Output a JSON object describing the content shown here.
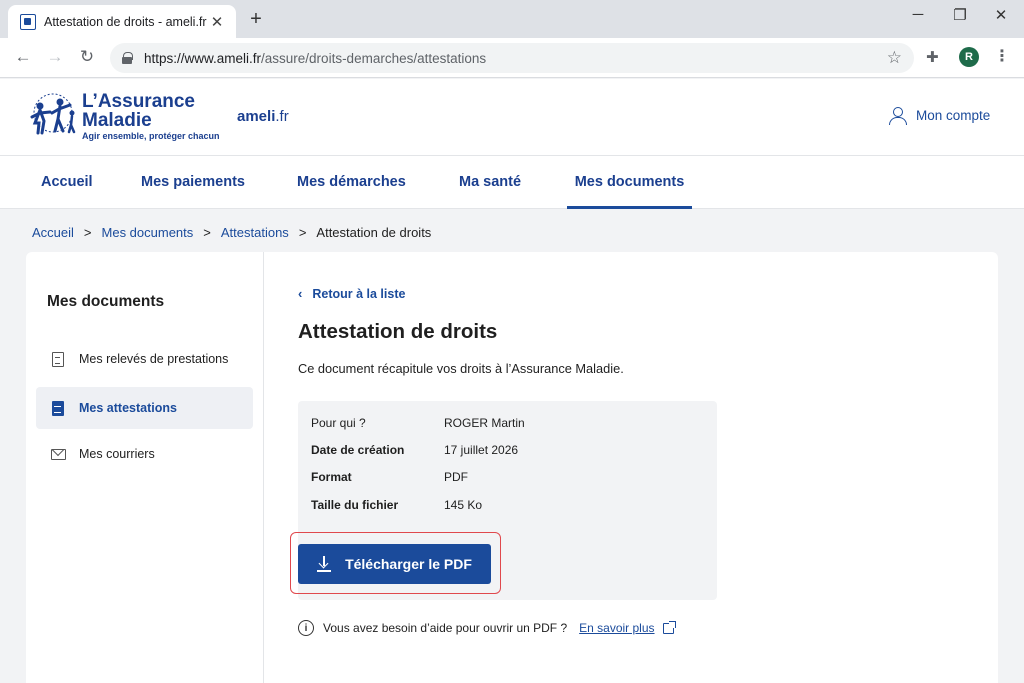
{
  "browser": {
    "tab_title": "Attestation de droits - ameli.fr",
    "tab_close": "✕",
    "new_tab": "+",
    "url_domain": "https://www.ameli.fr",
    "url_path": "/assure/droits-demarches/attestations",
    "profile_initial": "R",
    "icons": [
      "back-arrow-icon",
      "forward-arrow-icon",
      "reload-icon",
      "lock-icon",
      "star-icon",
      "extensions-icon",
      "kebab-menu-icon"
    ]
  },
  "header": {
    "logo_line1": "L’Assurance",
    "logo_line2": "Maladie",
    "logo_tagline": "Agir ensemble, protéger chacun",
    "site_name": "ameli",
    "site_tld": ".fr",
    "account_label": "Mon compte"
  },
  "nav": {
    "items": [
      {
        "label": "Accueil"
      },
      {
        "label": "Mes paiements"
      },
      {
        "label": "Mes démarches"
      },
      {
        "label": "Ma santé"
      },
      {
        "label": "Mes documents",
        "active": true
      }
    ]
  },
  "breadcrumb": {
    "items": [
      "Accueil",
      "Mes documents",
      "Attestations"
    ],
    "separator": ">",
    "current": "Attestation de droits"
  },
  "sidebar": {
    "title": "Mes documents",
    "items": [
      {
        "label": "Mes relevés de prestations",
        "icon": "document-icon"
      },
      {
        "label": "Mes attestations",
        "icon": "document-filled-icon",
        "active": true
      },
      {
        "label": "Mes courriers",
        "icon": "envelope-icon"
      }
    ]
  },
  "main": {
    "back_label": "Retour à la liste",
    "title": "Attestation de droits",
    "description": "Ce document récapitule vos droits à l’Assurance Maladie.",
    "details": [
      {
        "key": "Pour qui ?",
        "value": "ROGER Martin"
      },
      {
        "key": "Date de création",
        "value": "17 juillet 2026"
      },
      {
        "key": "Format",
        "value": "PDF"
      },
      {
        "key": "Taille du fichier",
        "value": "145 Ko"
      }
    ],
    "download_label": "Télécharger le PDF",
    "help_text": "Vous avez besoin d’aide pour ouvrir un PDF ?",
    "help_link": "En savoir plus"
  },
  "colors": {
    "brand_blue": "#1b4b9b",
    "highlight_red": "#e0484d"
  }
}
